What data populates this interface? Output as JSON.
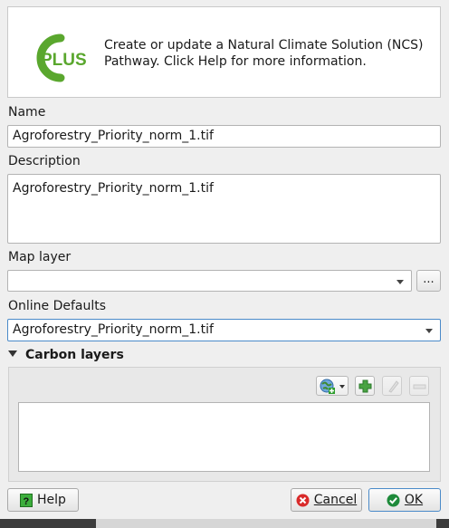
{
  "header": {
    "logo_text": "PLUS",
    "description": "Create or update a Natural Climate Solution (NCS) Pathway. Click Help for more information."
  },
  "form": {
    "name_label": "Name",
    "name_value": "Agroforestry_Priority_norm_1.tif",
    "description_label": "Description",
    "description_value": "Agroforestry_Priority_norm_1.tif",
    "map_layer_label": "Map layer",
    "map_layer_value": "",
    "browse_label": "...",
    "online_defaults_label": "Online Defaults",
    "online_defaults_value": "Agroforestry_Priority_norm_1.tif"
  },
  "carbon": {
    "section_label": "Carbon layers",
    "toolbar_icons": [
      "globe-add-icon",
      "plus-icon",
      "edit-icon",
      "remove-icon"
    ]
  },
  "buttons": {
    "help_label": "Help",
    "cancel_label": "Cancel",
    "ok_label": "OK"
  },
  "colors": {
    "brand_green": "#5aa72e",
    "accent_blue": "#4a8ac9",
    "ok_green": "#1e8a3a",
    "cancel_red": "#d92b2b"
  }
}
